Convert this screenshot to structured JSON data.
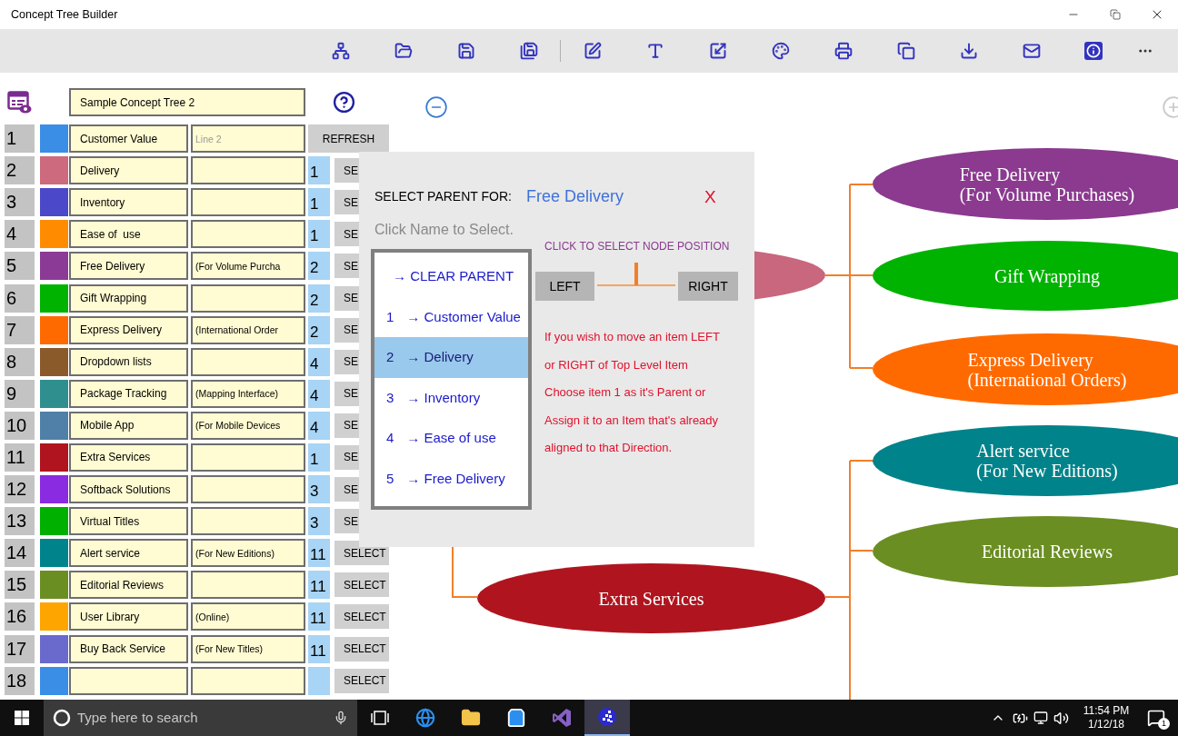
{
  "window": {
    "title": "Concept Tree Builder"
  },
  "tree_title": "Sample Concept Tree 2",
  "rows": [
    {
      "kind": "refresh",
      "number": "1",
      "color": "#3a8ee6",
      "name": "Customer Value",
      "line2_placeholder": "Line 2",
      "button": "REFRESH"
    },
    {
      "kind": "select",
      "number": "2",
      "color": "#cd6a7d",
      "name": "Delivery",
      "parent": "1",
      "button": "SE"
    },
    {
      "kind": "select",
      "number": "3",
      "color": "#4b48c9",
      "name": "Inventory",
      "parent": "1",
      "button": "SE"
    },
    {
      "kind": "select",
      "number": "4",
      "color": "#ff8c00",
      "name": "Ease of  use",
      "parent": "1",
      "button": "SE"
    },
    {
      "kind": "select",
      "number": "5",
      "color": "#8b3a95",
      "name": "Free Delivery",
      "line2": "(For Volume Purcha",
      "parent": "2",
      "button": "SE"
    },
    {
      "kind": "select",
      "number": "6",
      "color": "#00b300",
      "name": "Gift Wrapping",
      "parent": "2",
      "button": "SE"
    },
    {
      "kind": "select",
      "number": "7",
      "color": "#ff6a00",
      "name": "Express Delivery",
      "line2": "(International Order",
      "parent": "2",
      "button": "SE"
    },
    {
      "kind": "select",
      "number": "8",
      "color": "#8b5a2b",
      "name": "Dropdown lists",
      "parent": "4",
      "button": "SE"
    },
    {
      "kind": "select",
      "number": "9",
      "color": "#2f8f8f",
      "name": "Package Tracking",
      "line2": "(Mapping Interface)",
      "parent": "4",
      "button": "SE"
    },
    {
      "kind": "select",
      "number": "10",
      "color": "#5080a8",
      "name": "Mobile App",
      "line2": "(For Mobile Devices",
      "parent": "4",
      "button": "SE"
    },
    {
      "kind": "select",
      "number": "11",
      "color": "#b0141e",
      "name": "Extra Services",
      "parent": "1",
      "button": "SE"
    },
    {
      "kind": "select",
      "number": "12",
      "color": "#8a2be2",
      "name": "Softback Solutions",
      "parent": "3",
      "button": "SE"
    },
    {
      "kind": "select",
      "number": "13",
      "color": "#00b000",
      "name": "Virtual Titles",
      "parent": "3",
      "button": "SE"
    },
    {
      "kind": "select",
      "number": "14",
      "color": "#00838a",
      "name": "Alert service",
      "line2": "(For New Editions)",
      "parent": "11",
      "button": "SELECT"
    },
    {
      "kind": "select",
      "number": "15",
      "color": "#6b8e23",
      "name": "Editorial Reviews",
      "parent": "11",
      "button": "SELECT"
    },
    {
      "kind": "select",
      "number": "16",
      "color": "#ffa500",
      "name": "User Library",
      "line2": "(Online)",
      "parent": "11",
      "button": "SELECT"
    },
    {
      "kind": "select",
      "number": "17",
      "color": "#6a6acd",
      "name": "Buy Back Service",
      "line2": "(For New Titles)",
      "parent": "11",
      "button": "SELECT"
    },
    {
      "kind": "select",
      "number": "18",
      "color": "#3a8ee6",
      "button": "SELECT"
    }
  ],
  "tree": {
    "nodes": [
      {
        "color": "#c8677e"
      },
      {
        "color": "#8b3a8f",
        "lines": [
          "Free Delivery",
          "(For Volume Purchases)"
        ]
      },
      {
        "color": "#00b300",
        "lines": [
          "Gift Wrapping"
        ]
      },
      {
        "color": "#ff6a00",
        "lines": [
          "Express Delivery",
          "(International Orders)"
        ]
      },
      {
        "color": "#00838a",
        "lines": [
          "Alert service",
          "(For New Editions)"
        ]
      },
      {
        "color": "#6b8e23",
        "lines": [
          "Editorial Reviews"
        ]
      },
      {
        "color": "#b0151f",
        "lines": [
          "Extra Services"
        ]
      }
    ]
  },
  "dialog": {
    "heading": "SELECT PARENT FOR:",
    "target": "Free Delivery",
    "close": "X",
    "hint": "Click Name to Select.",
    "options": [
      {
        "label": "→ CLEAR PARENT",
        "selected": false
      },
      {
        "number": "1",
        "label": "→ Customer Value",
        "selected": false
      },
      {
        "number": "2",
        "label": "→ Delivery",
        "selected": true
      },
      {
        "number": "3",
        "label": "→ Inventory",
        "selected": false
      },
      {
        "number": "4",
        "label": "→ Ease of  use",
        "selected": false
      },
      {
        "number": "5",
        "label": "→ Free Delivery",
        "selected": false
      }
    ],
    "position_heading": "CLICK TO SELECT NODE POSITION",
    "position_buttons": [
      "LEFT",
      "RIGHT"
    ],
    "note_lines": [
      "If you wish to move an item LEFT",
      "or RIGHT of Top Level Item",
      "Choose item 1 as it's Parent or",
      "Assign it to an Item that's already",
      "aligned to that Direction."
    ]
  },
  "taskbar": {
    "search_placeholder": "Type here to search",
    "time": "11:54 PM",
    "date": "1/12/18",
    "notification_count": "1"
  }
}
